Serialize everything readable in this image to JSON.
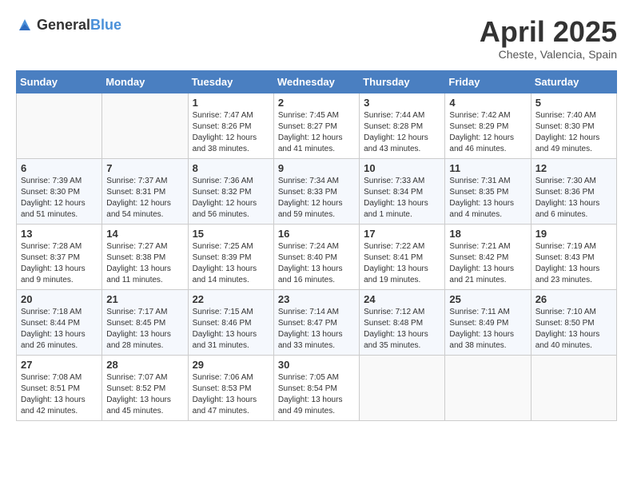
{
  "header": {
    "logo_general": "General",
    "logo_blue": "Blue",
    "month_title": "April 2025",
    "location": "Cheste, Valencia, Spain"
  },
  "weekdays": [
    "Sunday",
    "Monday",
    "Tuesday",
    "Wednesday",
    "Thursday",
    "Friday",
    "Saturday"
  ],
  "weeks": [
    [
      {
        "day": "",
        "sunrise": "",
        "sunset": "",
        "daylight": ""
      },
      {
        "day": "",
        "sunrise": "",
        "sunset": "",
        "daylight": ""
      },
      {
        "day": "1",
        "sunrise": "Sunrise: 7:47 AM",
        "sunset": "Sunset: 8:26 PM",
        "daylight": "Daylight: 12 hours and 38 minutes."
      },
      {
        "day": "2",
        "sunrise": "Sunrise: 7:45 AM",
        "sunset": "Sunset: 8:27 PM",
        "daylight": "Daylight: 12 hours and 41 minutes."
      },
      {
        "day": "3",
        "sunrise": "Sunrise: 7:44 AM",
        "sunset": "Sunset: 8:28 PM",
        "daylight": "Daylight: 12 hours and 43 minutes."
      },
      {
        "day": "4",
        "sunrise": "Sunrise: 7:42 AM",
        "sunset": "Sunset: 8:29 PM",
        "daylight": "Daylight: 12 hours and 46 minutes."
      },
      {
        "day": "5",
        "sunrise": "Sunrise: 7:40 AM",
        "sunset": "Sunset: 8:30 PM",
        "daylight": "Daylight: 12 hours and 49 minutes."
      }
    ],
    [
      {
        "day": "6",
        "sunrise": "Sunrise: 7:39 AM",
        "sunset": "Sunset: 8:30 PM",
        "daylight": "Daylight: 12 hours and 51 minutes."
      },
      {
        "day": "7",
        "sunrise": "Sunrise: 7:37 AM",
        "sunset": "Sunset: 8:31 PM",
        "daylight": "Daylight: 12 hours and 54 minutes."
      },
      {
        "day": "8",
        "sunrise": "Sunrise: 7:36 AM",
        "sunset": "Sunset: 8:32 PM",
        "daylight": "Daylight: 12 hours and 56 minutes."
      },
      {
        "day": "9",
        "sunrise": "Sunrise: 7:34 AM",
        "sunset": "Sunset: 8:33 PM",
        "daylight": "Daylight: 12 hours and 59 minutes."
      },
      {
        "day": "10",
        "sunrise": "Sunrise: 7:33 AM",
        "sunset": "Sunset: 8:34 PM",
        "daylight": "Daylight: 13 hours and 1 minute."
      },
      {
        "day": "11",
        "sunrise": "Sunrise: 7:31 AM",
        "sunset": "Sunset: 8:35 PM",
        "daylight": "Daylight: 13 hours and 4 minutes."
      },
      {
        "day": "12",
        "sunrise": "Sunrise: 7:30 AM",
        "sunset": "Sunset: 8:36 PM",
        "daylight": "Daylight: 13 hours and 6 minutes."
      }
    ],
    [
      {
        "day": "13",
        "sunrise": "Sunrise: 7:28 AM",
        "sunset": "Sunset: 8:37 PM",
        "daylight": "Daylight: 13 hours and 9 minutes."
      },
      {
        "day": "14",
        "sunrise": "Sunrise: 7:27 AM",
        "sunset": "Sunset: 8:38 PM",
        "daylight": "Daylight: 13 hours and 11 minutes."
      },
      {
        "day": "15",
        "sunrise": "Sunrise: 7:25 AM",
        "sunset": "Sunset: 8:39 PM",
        "daylight": "Daylight: 13 hours and 14 minutes."
      },
      {
        "day": "16",
        "sunrise": "Sunrise: 7:24 AM",
        "sunset": "Sunset: 8:40 PM",
        "daylight": "Daylight: 13 hours and 16 minutes."
      },
      {
        "day": "17",
        "sunrise": "Sunrise: 7:22 AM",
        "sunset": "Sunset: 8:41 PM",
        "daylight": "Daylight: 13 hours and 19 minutes."
      },
      {
        "day": "18",
        "sunrise": "Sunrise: 7:21 AM",
        "sunset": "Sunset: 8:42 PM",
        "daylight": "Daylight: 13 hours and 21 minutes."
      },
      {
        "day": "19",
        "sunrise": "Sunrise: 7:19 AM",
        "sunset": "Sunset: 8:43 PM",
        "daylight": "Daylight: 13 hours and 23 minutes."
      }
    ],
    [
      {
        "day": "20",
        "sunrise": "Sunrise: 7:18 AM",
        "sunset": "Sunset: 8:44 PM",
        "daylight": "Daylight: 13 hours and 26 minutes."
      },
      {
        "day": "21",
        "sunrise": "Sunrise: 7:17 AM",
        "sunset": "Sunset: 8:45 PM",
        "daylight": "Daylight: 13 hours and 28 minutes."
      },
      {
        "day": "22",
        "sunrise": "Sunrise: 7:15 AM",
        "sunset": "Sunset: 8:46 PM",
        "daylight": "Daylight: 13 hours and 31 minutes."
      },
      {
        "day": "23",
        "sunrise": "Sunrise: 7:14 AM",
        "sunset": "Sunset: 8:47 PM",
        "daylight": "Daylight: 13 hours and 33 minutes."
      },
      {
        "day": "24",
        "sunrise": "Sunrise: 7:12 AM",
        "sunset": "Sunset: 8:48 PM",
        "daylight": "Daylight: 13 hours and 35 minutes."
      },
      {
        "day": "25",
        "sunrise": "Sunrise: 7:11 AM",
        "sunset": "Sunset: 8:49 PM",
        "daylight": "Daylight: 13 hours and 38 minutes."
      },
      {
        "day": "26",
        "sunrise": "Sunrise: 7:10 AM",
        "sunset": "Sunset: 8:50 PM",
        "daylight": "Daylight: 13 hours and 40 minutes."
      }
    ],
    [
      {
        "day": "27",
        "sunrise": "Sunrise: 7:08 AM",
        "sunset": "Sunset: 8:51 PM",
        "daylight": "Daylight: 13 hours and 42 minutes."
      },
      {
        "day": "28",
        "sunrise": "Sunrise: 7:07 AM",
        "sunset": "Sunset: 8:52 PM",
        "daylight": "Daylight: 13 hours and 45 minutes."
      },
      {
        "day": "29",
        "sunrise": "Sunrise: 7:06 AM",
        "sunset": "Sunset: 8:53 PM",
        "daylight": "Daylight: 13 hours and 47 minutes."
      },
      {
        "day": "30",
        "sunrise": "Sunrise: 7:05 AM",
        "sunset": "Sunset: 8:54 PM",
        "daylight": "Daylight: 13 hours and 49 minutes."
      },
      {
        "day": "",
        "sunrise": "",
        "sunset": "",
        "daylight": ""
      },
      {
        "day": "",
        "sunrise": "",
        "sunset": "",
        "daylight": ""
      },
      {
        "day": "",
        "sunrise": "",
        "sunset": "",
        "daylight": ""
      }
    ]
  ]
}
